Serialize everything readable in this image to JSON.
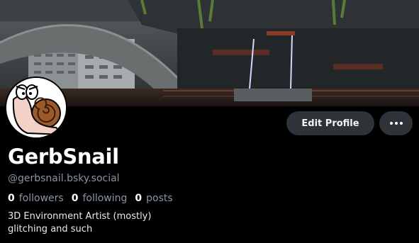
{
  "banner": {
    "icon": "industrial-scene-image"
  },
  "avatar": {
    "icon": "snail-avatar"
  },
  "actions": {
    "edit_profile_label": "Edit Profile",
    "more_icon": "ellipsis-icon"
  },
  "profile": {
    "display_name": "GerbSnail",
    "handle": "@gerbsnail.bsky.social",
    "bio_lines": [
      "3D Environment Artist (mostly)",
      "glitching and such"
    ]
  },
  "stats": [
    {
      "count": "0",
      "label": "followers"
    },
    {
      "count": "0",
      "label": "following"
    },
    {
      "count": "0",
      "label": "posts"
    }
  ],
  "colors": {
    "background": "#000000",
    "button_bg": "#2e3339",
    "secondary_text": "#8a95a1",
    "primary_text": "#ffffff"
  }
}
